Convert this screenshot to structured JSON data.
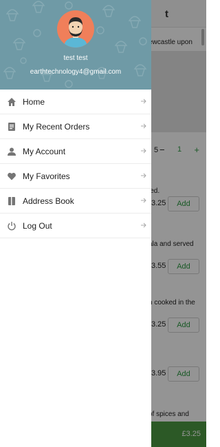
{
  "background": {
    "snippets": [
      "ewcastle upon",
      "ied.",
      "ala and served",
      "n cooked in the",
      "of spices and"
    ],
    "prices": [
      "3.25",
      "3.55",
      "3.25",
      "3.95"
    ],
    "stepper_left_digit": "5",
    "stepper_minus": "−",
    "stepper_value": "1",
    "stepper_plus": "+",
    "add_label": "Add",
    "cart_total": "£3.25",
    "header_glyph": "t"
  },
  "drawer": {
    "user_name": "test test",
    "email": "earthtechnology4@gmail.com",
    "items": [
      {
        "label": "Home",
        "icon": "home-icon"
      },
      {
        "label": "My Recent Orders",
        "icon": "orders-icon"
      },
      {
        "label": "My Account",
        "icon": "person-icon"
      },
      {
        "label": "My Favorites",
        "icon": "heart-icon"
      },
      {
        "label": "Address Book",
        "icon": "book-icon"
      },
      {
        "label": "Log Out",
        "icon": "power-icon"
      }
    ]
  },
  "colors": {
    "header_bg": "#6f9aa6",
    "avatar_bg": "#f07f5a",
    "accent_green": "#2e9b43",
    "cart_bar": "#4c9a42"
  }
}
